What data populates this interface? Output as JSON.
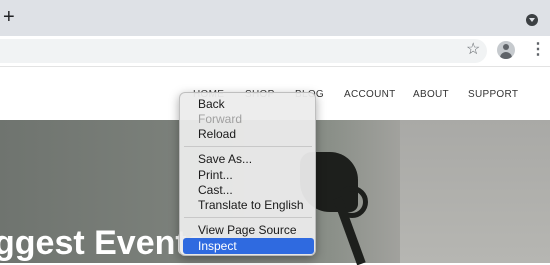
{
  "browser": {
    "new_tab_label": "+",
    "star_label": "☆",
    "menu_label": "⋮"
  },
  "nav": {
    "items": [
      "HOME",
      "SHOP",
      "BLOG",
      "ACCOUNT",
      "ABOUT",
      "SUPPORT"
    ]
  },
  "hero": {
    "title": "ggest Events"
  },
  "context_menu": {
    "items": [
      {
        "label": "Back"
      },
      {
        "label": "Forward"
      },
      {
        "label": "Reload"
      },
      {
        "label": "Save As..."
      },
      {
        "label": "Print..."
      },
      {
        "label": "Cast..."
      },
      {
        "label": "Translate to English"
      },
      {
        "label": "View Page Source"
      },
      {
        "label": "Inspect"
      }
    ],
    "highlight_color": "#2f6ae0"
  }
}
